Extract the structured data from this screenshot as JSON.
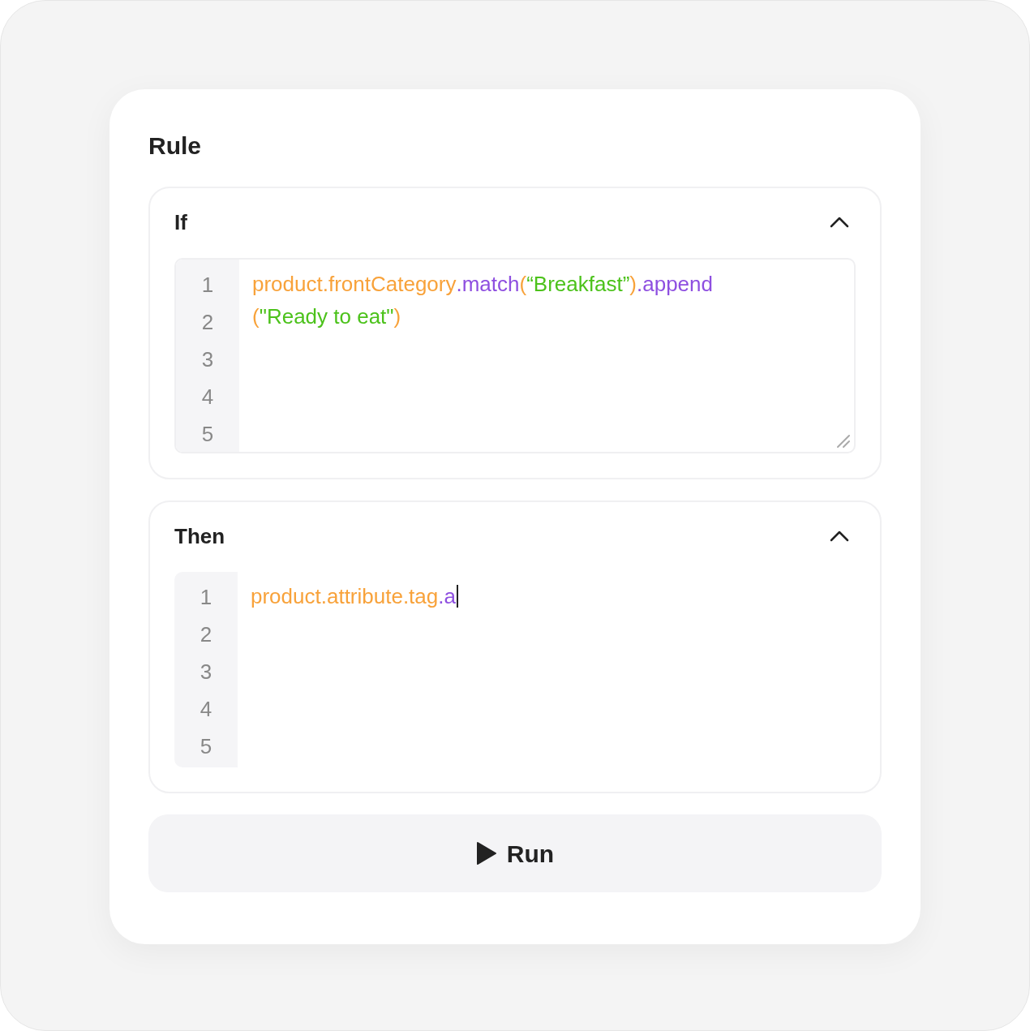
{
  "title": "Rule",
  "sections": [
    {
      "label": "If",
      "expanded": true,
      "editor": {
        "bordered": true,
        "line_numbers": [
          "1",
          "2",
          "3",
          "4",
          "5"
        ],
        "lines": [
          [
            {
              "kind": "property",
              "text": "product.frontCategory"
            },
            {
              "kind": "method",
              "text": ".match"
            },
            {
              "kind": "property",
              "text": "("
            },
            {
              "kind": "string",
              "text": "“Breakfast”"
            },
            {
              "kind": "property",
              "text": ")"
            },
            {
              "kind": "method",
              "text": ".append"
            }
          ],
          [
            {
              "kind": "property",
              "text": "("
            },
            {
              "kind": "string",
              "text": "\"Ready to eat\""
            },
            {
              "kind": "property",
              "text": ")"
            }
          ]
        ],
        "cursor": false
      }
    },
    {
      "label": "Then",
      "expanded": true,
      "editor": {
        "bordered": false,
        "line_numbers": [
          "1",
          "2",
          "3",
          "4",
          "5"
        ],
        "lines": [
          [
            {
              "kind": "property",
              "text": "product.attribute.tag"
            },
            {
              "kind": "method",
              "text": ".a"
            }
          ]
        ],
        "cursor": true
      }
    }
  ],
  "run_button": {
    "label": "Run"
  }
}
